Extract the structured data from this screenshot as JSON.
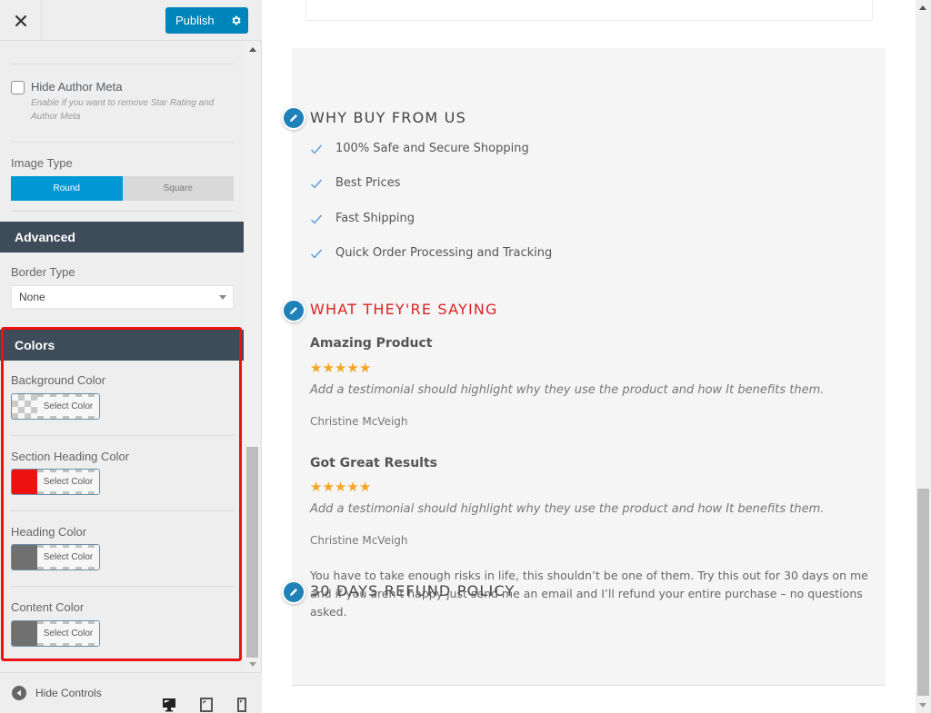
{
  "topbar": {
    "close_icon": "close-icon",
    "publish_label": "Publish",
    "settings_icon": "gear-icon"
  },
  "sidebar": {
    "hide_author_meta": {
      "label": "Hide Author Meta",
      "description": "Enable if you want to remove Star Rating and Author Meta",
      "checked": false
    },
    "image_type": {
      "label": "Image Type",
      "options": [
        "Round",
        "Square"
      ],
      "selected": "Round"
    },
    "advanced": {
      "title": "Advanced",
      "border_type": {
        "label": "Border Type",
        "value": "None"
      }
    },
    "colors": {
      "title": "Colors",
      "items": [
        {
          "label": "Background Color",
          "button": "Select Color",
          "color": "transparent"
        },
        {
          "label": "Section Heading Color",
          "button": "Select Color",
          "color": "#ee1111"
        },
        {
          "label": "Heading Color",
          "button": "Select Color",
          "color": "#707070"
        },
        {
          "label": "Content Color",
          "button": "Select Color",
          "color": "#707070"
        }
      ]
    },
    "footer": {
      "hide_controls": "Hide Controls",
      "devices": [
        "desktop",
        "tablet",
        "mobile"
      ],
      "active_device": "desktop"
    }
  },
  "preview": {
    "why_buy": {
      "title": "WHY BUY FROM US",
      "items": [
        "100% Safe and Secure Shopping",
        "Best Prices",
        "Fast Shipping",
        "Quick Order Processing and Tracking"
      ]
    },
    "testimonials": {
      "title": "WHAT THEY'RE SAYING",
      "items": [
        {
          "title": "Amazing Product",
          "rating": 5,
          "quote": "Add a testimonial should highlight why they use the product and how It benefits them.",
          "author": "Christine McVeigh"
        },
        {
          "title": "Got Great Results",
          "rating": 5,
          "quote": "Add a testimonial should highlight why they use the product and how It benefits them.",
          "author": "Christine McVeigh"
        }
      ]
    },
    "refund": {
      "title": "30 DAYS REFUND POLICY",
      "text": "You have to take enough risks in life, this shouldn’t be one of them. Try this out for 30 days on me and if you aren’t happy just send me an email and I’ll refund your entire purchase – no questions asked."
    }
  },
  "colors": {
    "accent": "#0085ba",
    "toggle_active": "#0099d5",
    "section_header": "#3e4b59",
    "highlight_border": "#ee1111",
    "edit_icon": "#1e82b8",
    "star": "#f5a623",
    "section_heading_red": "#dd2222"
  }
}
